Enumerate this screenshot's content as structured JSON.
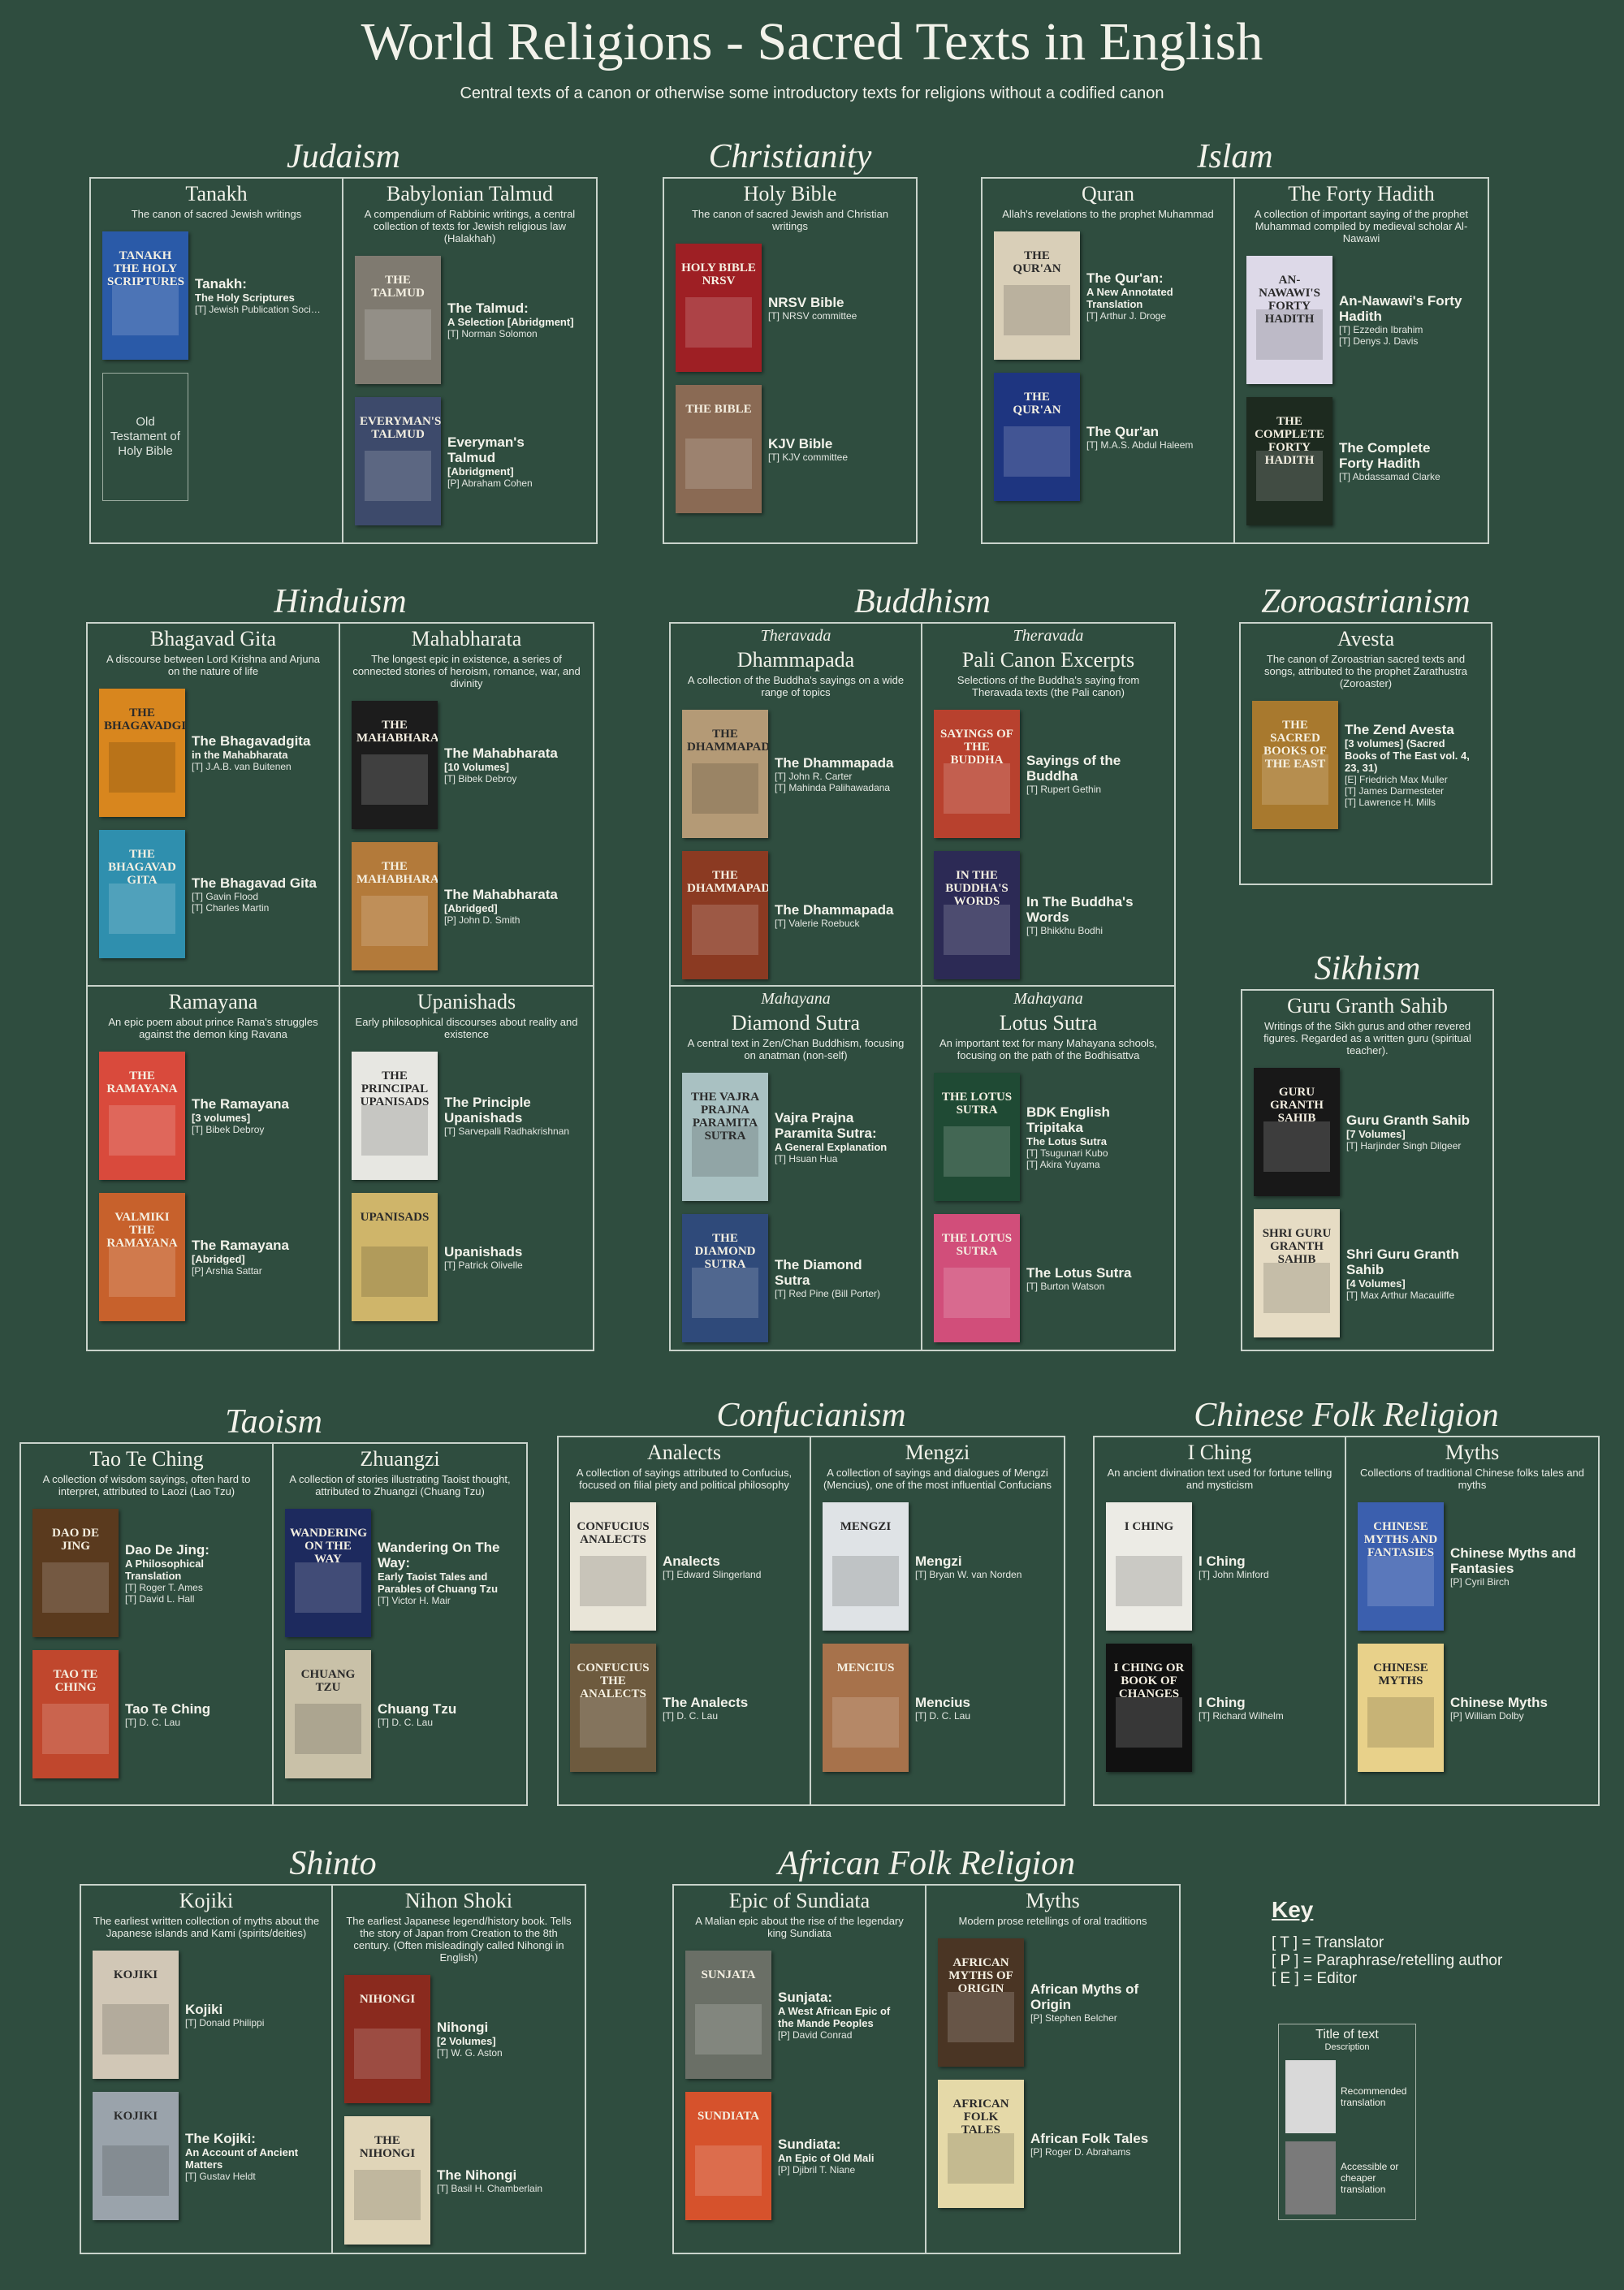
{
  "title": "World Religions - Sacred Texts in English",
  "subtitle": "Central texts of a canon or otherwise some introductory texts for religions without a codified canon",
  "religions": [
    {
      "name": "Judaism",
      "texts": [
        {
          "title": "Tanakh",
          "desc": "The canon of sacred Jewish writings",
          "books": [
            {
              "title": "Tanakh:",
              "sub": "The Holy Scriptures",
              "people": [
                "[T] Jewish Publication Society"
              ],
              "cover_text": "Tanakh The Holy Scriptures",
              "color": "#2a5aa8"
            },
            {
              "placeholder": "Old Testament of Holy Bible"
            }
          ]
        },
        {
          "title": "Babylonian Talmud",
          "desc": "A compendium of Rabbinic writings, a central collection of texts for Jewish religious law (Halakhah)",
          "books": [
            {
              "title": "The Talmud:",
              "sub": "A Selection [Abridgment]",
              "people": [
                "[T] Norman Solomon"
              ],
              "cover_text": "The Talmud",
              "color": "#7f7a70"
            },
            {
              "title": "Everyman's Talmud",
              "sub": "[Abridgment]",
              "people": [
                "[P] Abraham Cohen"
              ],
              "cover_text": "Everyman's Talmud",
              "color": "#3d4a6b"
            }
          ]
        }
      ]
    },
    {
      "name": "Christianity",
      "texts": [
        {
          "title": "Holy Bible",
          "desc": "The canon of sacred Jewish and Christian writings",
          "books": [
            {
              "title": "NRSV Bible",
              "sub": "",
              "people": [
                "[T] NRSV committee"
              ],
              "cover_text": "Holy Bible NRSV",
              "color": "#9e1f24"
            },
            {
              "title": "KJV Bible",
              "sub": "",
              "people": [
                "[T] KJV committee"
              ],
              "cover_text": "The Bible",
              "color": "#8a6a54"
            }
          ]
        }
      ]
    },
    {
      "name": "Islam",
      "texts": [
        {
          "title": "Quran",
          "desc": "Allah's revelations to the prophet Muhammad",
          "books": [
            {
              "title": "The Qur'an:",
              "sub": "A New Annotated Translation",
              "people": [
                "[T] Arthur J. Droge"
              ],
              "cover_text": "The Qur'an",
              "color": "#d9cfb8"
            },
            {
              "title": "The Qur'an",
              "sub": "",
              "people": [
                "[T] M.A.S. Abdul Haleem"
              ],
              "cover_text": "The Qur'an",
              "color": "#1e3580"
            }
          ]
        },
        {
          "title": "The Forty Hadith",
          "desc": "A collection of important saying of the prophet Muhammad compiled by medieval scholar Al-Nawawi",
          "books": [
            {
              "title": "An-Nawawi's Forty Hadith",
              "sub": "",
              "people": [
                "[T] Ezzedin Ibrahim",
                "[T] Denys J. Davis"
              ],
              "cover_text": "An-Nawawi's Forty Hadith",
              "color": "#ddd9e8"
            },
            {
              "title": "The Complete Forty Hadith",
              "sub": "",
              "people": [
                "[T] Abdassamad Clarke"
              ],
              "cover_text": "The Complete Forty Hadith",
              "color": "#1d2a1f"
            }
          ]
        }
      ]
    },
    {
      "name": "Hinduism",
      "texts": [
        {
          "title": "Bhagavad Gita",
          "desc": "A discourse between Lord Krishna and Arjuna on the nature of life",
          "books": [
            {
              "title": "The Bhagavadgita",
              "sub": "in the Mahabharata",
              "people": [
                "[T] J.A.B. van Buitenen"
              ],
              "cover_text": "The Bhagavadgita",
              "color": "#d8861e"
            },
            {
              "title": "The Bhagavad Gita",
              "sub": "",
              "people": [
                "[T] Gavin Flood",
                "[T] Charles Martin"
              ],
              "cover_text": "The Bhagavad Gita",
              "color": "#2f8fae"
            }
          ]
        },
        {
          "title": "Mahabharata",
          "desc": "The longest epic in existence, a series of connected stories of heroism, romance, war, and divinity",
          "books": [
            {
              "title": "The Mahabharata",
              "sub": "[10 Volumes]",
              "people": [
                "[T] Bibek Debroy"
              ],
              "cover_text": "The Mahabharata",
              "color": "#1c1c1c"
            },
            {
              "title": "The Mahabharata",
              "sub": "[Abridged]",
              "people": [
                "[P] John D. Smith"
              ],
              "cover_text": "The Mahabharata",
              "color": "#b37a3a"
            }
          ]
        },
        {
          "title": "Ramayana",
          "desc": "An epic poem about prince Rama's struggles against the demon king Ravana",
          "books": [
            {
              "title": "The Ramayana",
              "sub": "[3 volumes]",
              "people": [
                "[T] Bibek Debroy"
              ],
              "cover_text": "The Ramayana",
              "color": "#d94a3c"
            },
            {
              "title": "The Ramayana",
              "sub": "[Abridged]",
              "people": [
                "[P] Arshia Sattar"
              ],
              "cover_text": "Valmiki The Ramayana",
              "color": "#c7612c"
            }
          ]
        },
        {
          "title": "Upanishads",
          "desc": "Early philosophical discourses about reality and existence",
          "books": [
            {
              "title": "The Principle Upanishads",
              "sub": "",
              "people": [
                "[T] Sarvepalli Radhakrishnan"
              ],
              "cover_text": "The Principal Upanisads",
              "color": "#e7e7e2"
            },
            {
              "title": "Upanishads",
              "sub": "",
              "people": [
                "[T] Patrick Olivelle"
              ],
              "cover_text": "Upanisads",
              "color": "#cfb56a"
            }
          ]
        }
      ]
    },
    {
      "name": "Buddhism",
      "texts": [
        {
          "school": "Theravada",
          "title": "Dhammapada",
          "desc": "A collection of the Buddha's sayings on a wide range of topics",
          "books": [
            {
              "title": "The Dhammapada",
              "sub": "",
              "people": [
                "[T] John R. Carter",
                "[T] Mahinda Palihawadana"
              ],
              "cover_text": "The Dhammapada",
              "color": "#b49a76"
            },
            {
              "title": "The Dhammapada",
              "sub": "",
              "people": [
                "[T] Valerie Roebuck"
              ],
              "cover_text": "The Dhammapada",
              "color": "#8b3a22"
            }
          ]
        },
        {
          "school": "Theravada",
          "title": "Pali Canon Excerpts",
          "desc": "Selections of the Buddha's saying from Theravada texts (the Pali canon)",
          "books": [
            {
              "title": "Sayings of the Buddha",
              "sub": "",
              "people": [
                "[T] Rupert Gethin"
              ],
              "cover_text": "Sayings of the Buddha",
              "color": "#b8412e"
            },
            {
              "title": "In The Buddha's Words",
              "sub": "",
              "people": [
                "[T] Bhikkhu Bodhi"
              ],
              "cover_text": "In the Buddha's Words",
              "color": "#2c2a55"
            }
          ]
        },
        {
          "school": "Mahayana",
          "title": "Diamond Sutra",
          "desc": "A central text in Zen/Chan Buddhism, focusing on anatman (non-self)",
          "books": [
            {
              "title": "Vajra Prajna Paramita Sutra:",
              "sub": "A General Explanation",
              "people": [
                "[T] Hsuan Hua"
              ],
              "cover_text": "The Vajra Prajna Paramita Sutra",
              "color": "#a9c1c2"
            },
            {
              "title": "The Diamond Sutra",
              "sub": "",
              "people": [
                "[T] Red Pine (Bill Porter)"
              ],
              "cover_text": "The Diamond Sutra",
              "color": "#2f4a7a"
            }
          ]
        },
        {
          "school": "Mahayana",
          "title": "Lotus Sutra",
          "desc": "An important text for many Mahayana schools, focusing on the path of the Bodhisattva",
          "books": [
            {
              "title": "BDK English Tripitaka",
              "sub": "The Lotus Sutra",
              "people": [
                "[T] Tsugunari Kubo",
                "[T] Akira Yuyama"
              ],
              "cover_text": "The Lotus Sutra",
              "color": "#1f4a34"
            },
            {
              "title": "The Lotus Sutra",
              "sub": "",
              "people": [
                "[T] Burton Watson"
              ],
              "cover_text": "The Lotus Sutra",
              "color": "#d14e7a"
            }
          ]
        }
      ]
    },
    {
      "name": "Zoroastrianism",
      "texts": [
        {
          "title": "Avesta",
          "desc": "The canon of Zoroastrian sacred texts and songs, attributed to the prophet Zarathustra (Zoroaster)",
          "books": [
            {
              "title": "The Zend Avesta",
              "sub": "[3 volumes] (Sacred Books of The East vol. 4, 23, 31)",
              "people": [
                "[E] Friedrich Max Muller",
                "[T] James Darmesteter",
                "[T] Lawrence H. Mills"
              ],
              "cover_text": "The Sacred Books of the East",
              "color": "#a8792e"
            }
          ]
        }
      ]
    },
    {
      "name": "Sikhism",
      "texts": [
        {
          "title": "Guru Granth Sahib",
          "desc": "Writings of the Sikh gurus and other revered figures. Regarded as a written guru (spiritual teacher).",
          "books": [
            {
              "title": "Guru Granth Sahib",
              "sub": "[7 Volumes]",
              "people": [
                "[T] Harjinder Singh Dilgeer"
              ],
              "cover_text": "Guru Granth Sahib",
              "color": "#181818"
            },
            {
              "title": "Shri Guru Granth Sahib",
              "sub": "[4 Volumes]",
              "people": [
                "[T] Max Arthur Macauliffe"
              ],
              "cover_text": "Shri Guru Granth Sahib",
              "color": "#e6dcc4"
            }
          ]
        }
      ]
    },
    {
      "name": "Taoism",
      "texts": [
        {
          "title": "Tao Te Ching",
          "desc": "A collection of wisdom sayings, often hard to interpret, attributed to Laozi (Lao Tzu)",
          "books": [
            {
              "title": "Dao De Jing:",
              "sub": "A Philosophical Translation",
              "people": [
                "[T] Roger T. Ames",
                "[T] David L. Hall"
              ],
              "cover_text": "Dao De Jing",
              "color": "#5a3a1e"
            },
            {
              "title": "Tao Te Ching",
              "sub": "",
              "people": [
                "[T] D. C. Lau"
              ],
              "cover_text": "Tao Te Ching",
              "color": "#c0472d"
            }
          ]
        },
        {
          "title": "Zhuangzi",
          "desc": "A collection of stories illustrating Taoist thought, attributed to Zhuangzi (Chuang Tzu)",
          "books": [
            {
              "title": "Wandering On The Way:",
              "sub": "Early Taoist Tales and Parables of Chuang Tzu",
              "people": [
                "[T] Victor H. Mair"
              ],
              "cover_text": "Wandering on the Way",
              "color": "#1d2a5e"
            },
            {
              "title": "Chuang Tzu",
              "sub": "",
              "people": [
                "[T] D. C. Lau"
              ],
              "cover_text": "Chuang Tzu",
              "color": "#c9c1a8"
            }
          ]
        }
      ]
    },
    {
      "name": "Confucianism",
      "texts": [
        {
          "title": "Analects",
          "desc": "A collection of sayings attributed to Confucius, focused on filial piety and political philosophy",
          "books": [
            {
              "title": "Analects",
              "sub": "",
              "people": [
                "[T] Edward Slingerland"
              ],
              "cover_text": "Confucius Analects",
              "color": "#e9e5d8"
            },
            {
              "title": "The Analects",
              "sub": "",
              "people": [
                "[T] D. C. Lau"
              ],
              "cover_text": "Confucius The Analects",
              "color": "#6d5a3e"
            }
          ]
        },
        {
          "title": "Mengzi",
          "desc": "A collection of sayings and dialogues of Mengzi (Mencius), one of the most influential Confucians",
          "books": [
            {
              "title": "Mengzi",
              "sub": "",
              "people": [
                "[T] Bryan W. van Norden"
              ],
              "cover_text": "Mengzi",
              "color": "#dfe3e6"
            },
            {
              "title": "Mencius",
              "sub": "",
              "people": [
                "[T] D. C. Lau"
              ],
              "cover_text": "Mencius",
              "color": "#a7724b"
            }
          ]
        }
      ]
    },
    {
      "name": "Chinese Folk Religion",
      "texts": [
        {
          "title": "I Ching",
          "desc": "An ancient divination text used for fortune telling and mysticism",
          "books": [
            {
              "title": "I Ching",
              "sub": "",
              "people": [
                "[T] John Minford"
              ],
              "cover_text": "I Ching",
              "color": "#ecebe5"
            },
            {
              "title": "I Ching",
              "sub": "",
              "people": [
                "[T] Richard Wilhelm"
              ],
              "cover_text": "I Ching or book of changes",
              "color": "#111111"
            }
          ]
        },
        {
          "title": "Myths",
          "desc": "Collections of traditional Chinese folks tales and myths",
          "books": [
            {
              "title": "Chinese Myths and Fantasies",
              "sub": "",
              "people": [
                "[P] Cyril Birch"
              ],
              "cover_text": "Chinese Myths and Fantasies",
              "color": "#3b5fae"
            },
            {
              "title": "Chinese Myths",
              "sub": "",
              "people": [
                "[P] William Dolby"
              ],
              "cover_text": "Chinese Myths",
              "color": "#e8d18a"
            }
          ]
        }
      ]
    },
    {
      "name": "Shinto",
      "texts": [
        {
          "title": "Kojiki",
          "desc": "The earliest written collection of myths about the Japanese islands and Kami (spirits/deities)",
          "books": [
            {
              "title": "Kojiki",
              "sub": "",
              "people": [
                "[T] Donald Philippi"
              ],
              "cover_text": "Kojiki",
              "color": "#d1c7b6"
            },
            {
              "title": "The Kojiki:",
              "sub": "An Account of Ancient Matters",
              "people": [
                "[T] Gustav Heldt"
              ],
              "cover_text": "Kojiki",
              "color": "#9aa3ab"
            }
          ]
        },
        {
          "title": "Nihon Shoki",
          "desc": "The earliest Japanese legend/history book. Tells the story of Japan from Creation to the 8th century. (Often misleadingly called Nihongi in English)",
          "books": [
            {
              "title": "Nihongi",
              "sub": "[2 Volumes]",
              "people": [
                "[T] W. G. Aston"
              ],
              "cover_text": "Nihongi",
              "color": "#8a2a1e"
            },
            {
              "title": "The Nihongi",
              "sub": "",
              "people": [
                "[T] Basil H. Chamberlain"
              ],
              "cover_text": "The Nihongi",
              "color": "#e0d5b8"
            }
          ]
        }
      ]
    },
    {
      "name": "African Folk Religion",
      "texts": [
        {
          "title": "Epic of Sundiata",
          "desc": "A Malian epic about the rise of the legendary king Sundiata",
          "books": [
            {
              "title": "Sunjata:",
              "sub": "A West African Epic of the Mande Peoples",
              "people": [
                "[P] David Conrad"
              ],
              "cover_text": "Sunjata",
              "color": "#6a6f66"
            },
            {
              "title": "Sundiata:",
              "sub": "An Epic of Old Mali",
              "people": [
                "[P] Djibril T. Niane"
              ],
              "cover_text": "Sundiata",
              "color": "#d6522c"
            }
          ]
        },
        {
          "title": "Myths",
          "desc": "Modern prose retellings of oral traditions",
          "books": [
            {
              "title": "African Myths of Origin",
              "sub": "",
              "people": [
                "[P] Stephen Belcher"
              ],
              "cover_text": "African Myths of Origin",
              "color": "#4a3524"
            },
            {
              "title": "African Folk Tales",
              "sub": "",
              "people": [
                "[P] Roger D. Abrahams"
              ],
              "cover_text": "African Folk Tales",
              "color": "#e5d9a8"
            }
          ]
        }
      ]
    }
  ],
  "key": {
    "title": "Key",
    "lines": [
      "[ T ] = Translator",
      "[ P ] = Paraphrase/retelling author",
      "[ E ] = Editor"
    ],
    "box_title": "Title of text",
    "box_desc": "Description",
    "recommended": "Recommended translation",
    "accessible": "Accessible or cheaper translation",
    "recommended_color": "#d9d9d9",
    "accessible_color": "#7a7a7a"
  }
}
